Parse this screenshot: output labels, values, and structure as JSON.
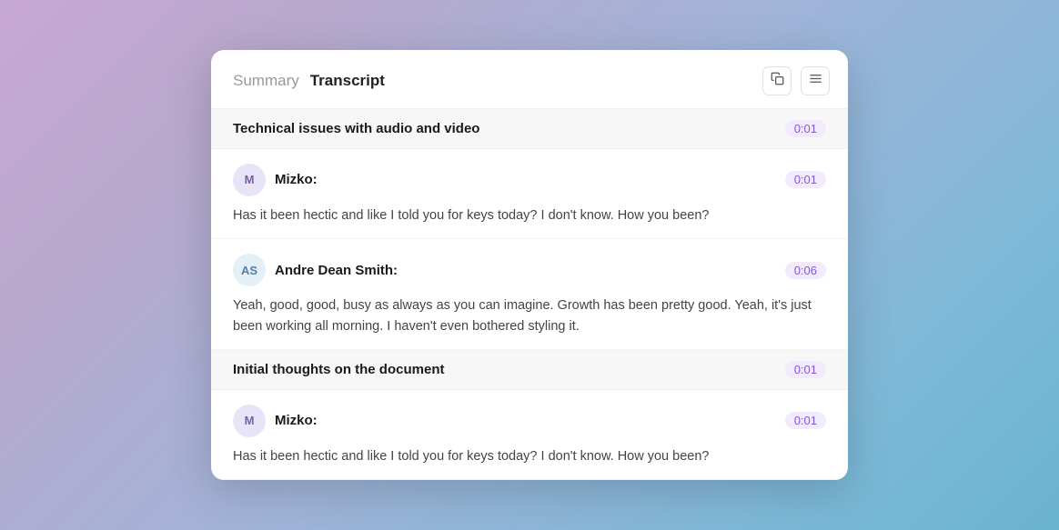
{
  "header": {
    "summary_label": "Summary",
    "transcript_label": "Transcript",
    "copy_icon": "⧉",
    "menu_icon": "☰"
  },
  "sections": [
    {
      "id": "section-1",
      "title": "Technical issues with audio and video",
      "time": "0:01",
      "messages": [
        {
          "id": "msg-1",
          "avatar_initials": "M",
          "avatar_type": "m",
          "speaker": "Mizko:",
          "time": "0:01",
          "text": "Has it been hectic and like I told you for keys today? I don't know. How you been?"
        },
        {
          "id": "msg-2",
          "avatar_initials": "AS",
          "avatar_type": "as",
          "speaker": "Andre Dean Smith:",
          "time": "0:06",
          "text": "Yeah, good, good, busy as always as you can imagine. Growth has been pretty good. Yeah, it's just been working all morning. I haven't even bothered styling it."
        }
      ]
    },
    {
      "id": "section-2",
      "title": "Initial thoughts on the document",
      "time": "0:01",
      "messages": [
        {
          "id": "msg-3",
          "avatar_initials": "M",
          "avatar_type": "m",
          "speaker": "Mizko:",
          "time": "0:01",
          "text": "Has it been hectic and like I told you for keys today? I don't know. How you been?"
        }
      ]
    }
  ]
}
